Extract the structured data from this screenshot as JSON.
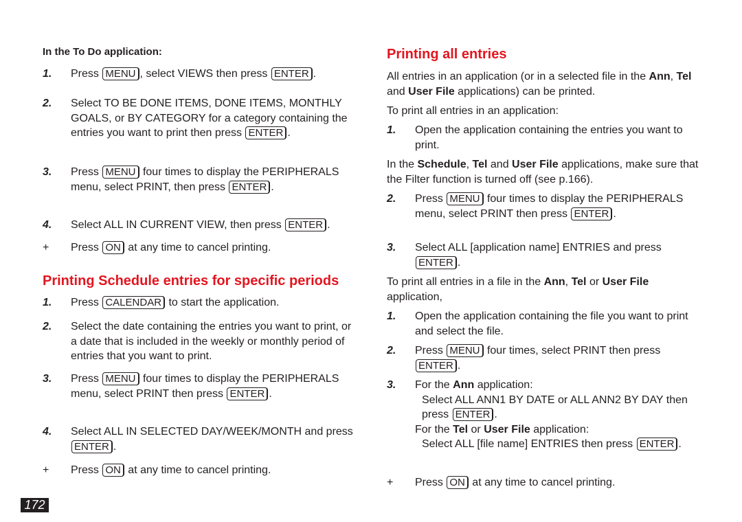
{
  "left": {
    "todo_subhead": "In the To Do application:",
    "todo_steps": [
      {
        "num": "1.",
        "parts": [
          "Press ",
          "MENU",
          ", select VIEWS then press ",
          "ENTER",
          "."
        ]
      },
      {
        "num": "2.",
        "parts": [
          "Select TO BE DONE ITEMS, DONE ITEMS, MONTHLY GOALS, or BY CATEGORY for a category containing the entries you want to print then press ",
          "ENTER",
          "."
        ]
      },
      {
        "num": "3.",
        "parts": [
          "Press ",
          "MENU",
          " four times to display the PERIPHERALS menu, select PRINT, then press ",
          "ENTER",
          "."
        ]
      },
      {
        "num": "4.",
        "parts": [
          "Select ALL IN CURRENT VIEW, then press ",
          "ENTER",
          "."
        ]
      },
      {
        "num": "+",
        "parts": [
          "Press ",
          "ON",
          " at any time to cancel printing."
        ]
      }
    ],
    "schedule_heading": "Printing Schedule entries for specific periods",
    "schedule_steps": [
      {
        "num": "1.",
        "parts": [
          "Press ",
          "CALENDAR",
          " to start the application."
        ]
      },
      {
        "num": "2.",
        "parts": [
          "Select the date containing the entries you want to print, or a date that is included in the weekly or monthly period of entries that you want to print."
        ]
      },
      {
        "num": "3.",
        "parts": [
          "Press ",
          "MENU",
          " four times to display the PERIPHERALS menu, select PRINT then press ",
          "ENTER",
          "."
        ]
      },
      {
        "num": "4.",
        "parts": [
          "Select ALL IN SELECTED DAY/WEEK/MONTH and press ",
          "ENTER",
          "."
        ]
      },
      {
        "num": "+",
        "parts": [
          "Press ",
          "ON",
          " at any time to cancel printing."
        ]
      }
    ]
  },
  "right": {
    "heading": "Printing all entries",
    "intro": {
      "t1": "All entries in an application (or in a selected file in the ",
      "b1": "Ann",
      "t2": ", ",
      "b2": "Tel",
      "t3": " and ",
      "b3": "User File",
      "t4": " applications) can be printed."
    },
    "to_print_app": "To print all entries in an application:",
    "app_step1": {
      "num": "1.",
      "text": "Open the application containing the entries you want to print."
    },
    "filter_note": {
      "t1": "In the ",
      "b1": "Schedule",
      "t2": ", ",
      "b2": "Tel",
      "t3": " and ",
      "b3": "User File",
      "t4": " applications, make sure that the Filter function is turned off (see p.166)."
    },
    "app_step2": {
      "num": "2.",
      "t1": "Press ",
      "k1": "MENU",
      "t2": " four times to display the PERIPHERALS menu, select PRINT then press ",
      "k2": "ENTER",
      "t3": "."
    },
    "app_step3": {
      "num": "3.",
      "t1": "Select ALL [application name] ENTRIES and press ",
      "k1": "ENTER",
      "t2": "."
    },
    "to_print_file": {
      "t1": "To print all entries in a file in the ",
      "b1": "Ann",
      "t2": ", ",
      "b2": "Tel",
      "t3": " or ",
      "b3": "User File",
      "t4": " application,"
    },
    "file_step1": {
      "num": "1.",
      "text": "Open the application containing the file you want to print and select the file."
    },
    "file_step2": {
      "num": "2.",
      "t1": "Press ",
      "k1": "MENU",
      "t2": " four times, select PRINT then press ",
      "k2": "ENTER",
      "t3": "."
    },
    "file_step3": {
      "num": "3.",
      "ann_t1": "For the ",
      "ann_b": "Ann",
      "ann_t2": " application:",
      "ann_sel": "Select ALL ANN1 BY DATE or ALL ANN2 BY DAY then press ",
      "ann_key": "ENTER",
      "ann_end": ".",
      "tel_t1": "For the ",
      "tel_b1": "Tel",
      "tel_t2": " or ",
      "tel_b2": "User File",
      "tel_t3": " application:",
      "tel_sel": "Select ALL [file name] ENTRIES then press ",
      "tel_key": "ENTER",
      "tel_end": "."
    },
    "cancel": {
      "num": "+",
      "t1": "Press ",
      "k1": "ON",
      "t2": " at any time to cancel printing."
    }
  },
  "page_number": "172",
  "colors": {
    "heading_red": "#e3151f",
    "text": "#231f20"
  }
}
